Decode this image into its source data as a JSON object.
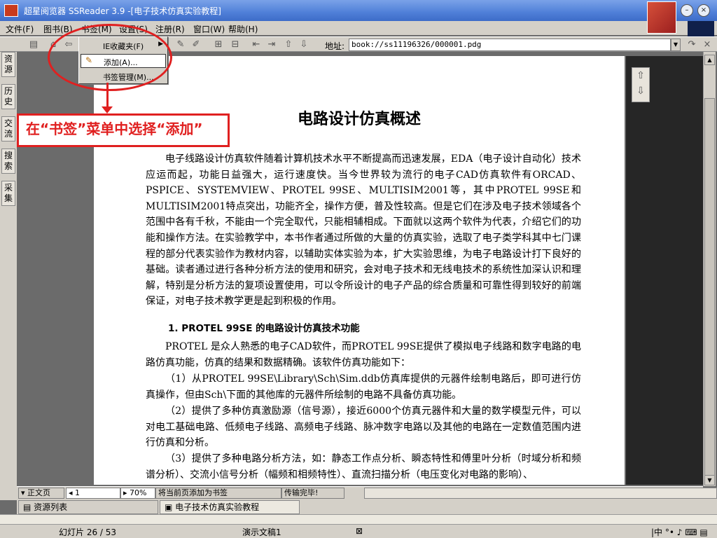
{
  "window": {
    "title": "超星阅览器 SSReader 3.9 -[电子技术仿真实验教程]"
  },
  "menubar": [
    "文件(F)",
    "图书(B)",
    "书签(M)",
    "设置(S)",
    "注册(R)",
    "窗口(W)",
    "帮助(H)"
  ],
  "toolbar": {
    "address_label": "地址:",
    "address_value": "book://ss11196326/000001.pdg"
  },
  "dropdown": {
    "items": [
      {
        "label": "IE收藏夹(F)",
        "has_submenu": true
      },
      {
        "label": "添加(A)...",
        "selected": true
      },
      {
        "label": "书签管理(M)..."
      }
    ]
  },
  "sidetabs": [
    "资源",
    "历史",
    "交流",
    "搜索",
    "采集"
  ],
  "callout": {
    "text": "在“书签”菜单中选择“添加”"
  },
  "document": {
    "title": "电路设计仿真概述",
    "intro_paragraph": "电子线路设计仿真软件随着计算机技术水平不断提高而迅速发展，EDA（电子设计自动化）技术应运而起，功能日益强大，运行速度快。当今世界较为流行的电子CAD仿真软件有ORCAD、PSPICE、SYSTEMVIEW、PROTEL 99SE、MULTISIM2001等，其中PROTEL 99SE和MULTISIM2001特点突出，功能齐全，操作方便，普及性较高。但是它们在涉及电子技术领域各个范围中各有千秋，不能由一个完全取代，只能相辅相成。下面就以这两个软件为代表，介绍它们的功能和操作方法。在实验教学中，本书作者通过所做的大量的仿真实验，选取了电子类学科其中七门课程的部分代表实验作为教材内容，以辅助实体实验为本，扩大实验思维，为电子电路设计打下良好的基础。读者通过进行各种分析方法的使用和研究，会对电子技术和无线电技术的系统性加深认识和理解，特别是分析方法的复项设置使用，可以令所设计的电子产品的综合质量和可靠性得到较好的前端保证，对电子技术教学更是起到积极的作用。",
    "section_heading": "1. PROTEL 99SE 的电路设计仿真技术功能",
    "section_intro": "PROTEL 是众人熟悉的电子CAD软件，而PROTEL 99SE提供了模拟电子线路和数字电路的电路仿真功能，仿真的结果和数据精确。该软件仿真功能如下：",
    "item1": "（1）从PROTEL 99SE\\Library\\Sch\\Sim.ddb仿真库提供的元器件绘制电路后，即可进行仿真操作，但由Sch\\下面的其他库的元器件所绘制的电路不具备仿真功能。",
    "item2": "（2）提供了多种仿真激励源（信号源），接近6000个仿真元器件和大量的数学模型元件，可以对电工基础电路、低频电子线路、高频电子线路、脉冲数字电路以及其他的电路在一定数值范围内进行仿真和分析。",
    "item3": "（3）提供了多种电路分析方法，如：静态工作点分析、瞬态特性和傅里叶分析（时域分析和频谱分析）、交流小信号分析（幅频和相频特性）、直流扫描分析（电压变化对电路的影响）、"
  },
  "docstatus": {
    "page_mode": "正文页",
    "page_number": "1",
    "zoom": "70%",
    "hint": "将当前页添加为书签",
    "transfer": "传输完毕!"
  },
  "tasktabs": [
    "资源列表",
    "电子技术仿真实验教程"
  ],
  "pptstatus": {
    "slide": "幻灯片 26 / 53",
    "template": "演示文稿1"
  },
  "colors": {
    "annotation": "#e02020",
    "ui_gray": "#d4d0c8",
    "titlebar": "#4f7fd8"
  }
}
